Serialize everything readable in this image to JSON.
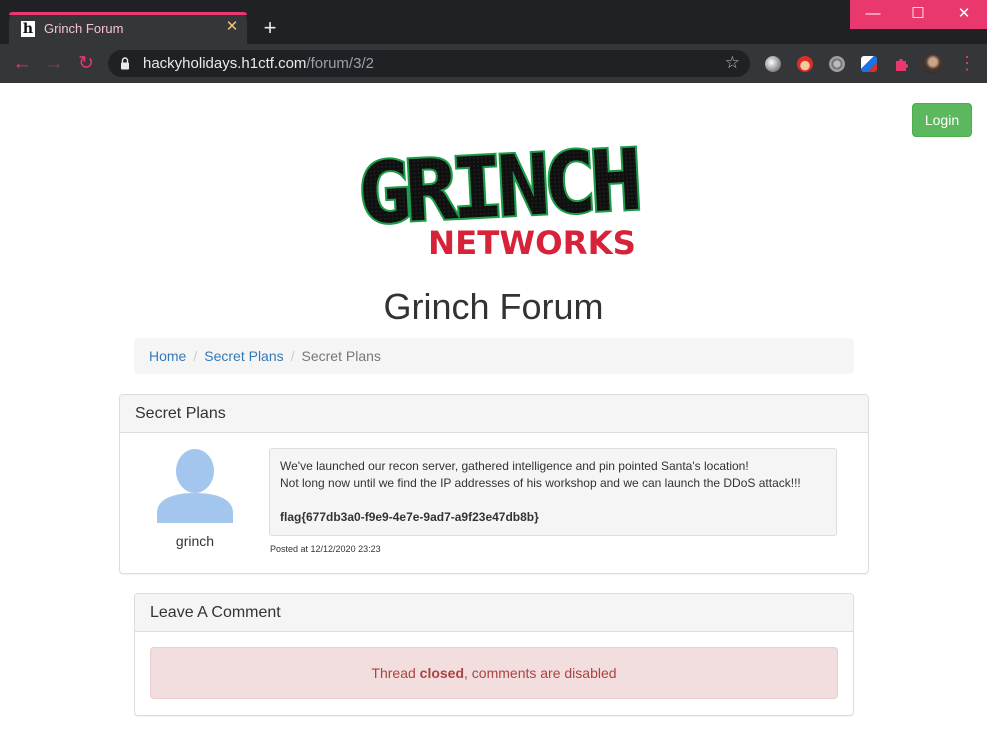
{
  "browser": {
    "tab_title": "Grinch Forum",
    "tab_favicon": "h",
    "tab_close": "✕",
    "new_tab": "+",
    "window_controls": {
      "minimize": "—",
      "maximize": "☐",
      "close": "✕"
    },
    "nav": {
      "back": "←",
      "forward": "→",
      "reload": "↻",
      "menu": "⋮"
    },
    "url_domain": "hackyholidays.h1ctf.com",
    "url_path": "/forum/3/2",
    "bookmark_icon": "☆",
    "accent_color": "#e8386d"
  },
  "header": {
    "login_label": "Login",
    "logo_alt": "GRINCH NETWORKS",
    "logo_top": "GRINCH",
    "logo_bottom": "NETWORKS"
  },
  "page": {
    "title": "Grinch Forum"
  },
  "breadcrumb": {
    "items": [
      "Home",
      "Secret Plans",
      "Secret Plans"
    ],
    "separator": "/"
  },
  "thread": {
    "title": "Secret Plans",
    "post": {
      "author": "grinch",
      "line1": "We've launched our recon server, gathered intelligence and pin pointed Santa's location!",
      "line2": "Not long now until we find the IP addresses of his workshop and we can launch the DDoS attack!!!",
      "flag": "flag{677db3a0-f9e9-4e7e-9ad7-a9f23e47db8b}",
      "posted_at": "Posted at 12/12/2020 23:23"
    }
  },
  "comment": {
    "title": "Leave A Comment",
    "alert_prefix": "Thread ",
    "alert_bold": "closed",
    "alert_suffix": ", comments are disabled"
  }
}
